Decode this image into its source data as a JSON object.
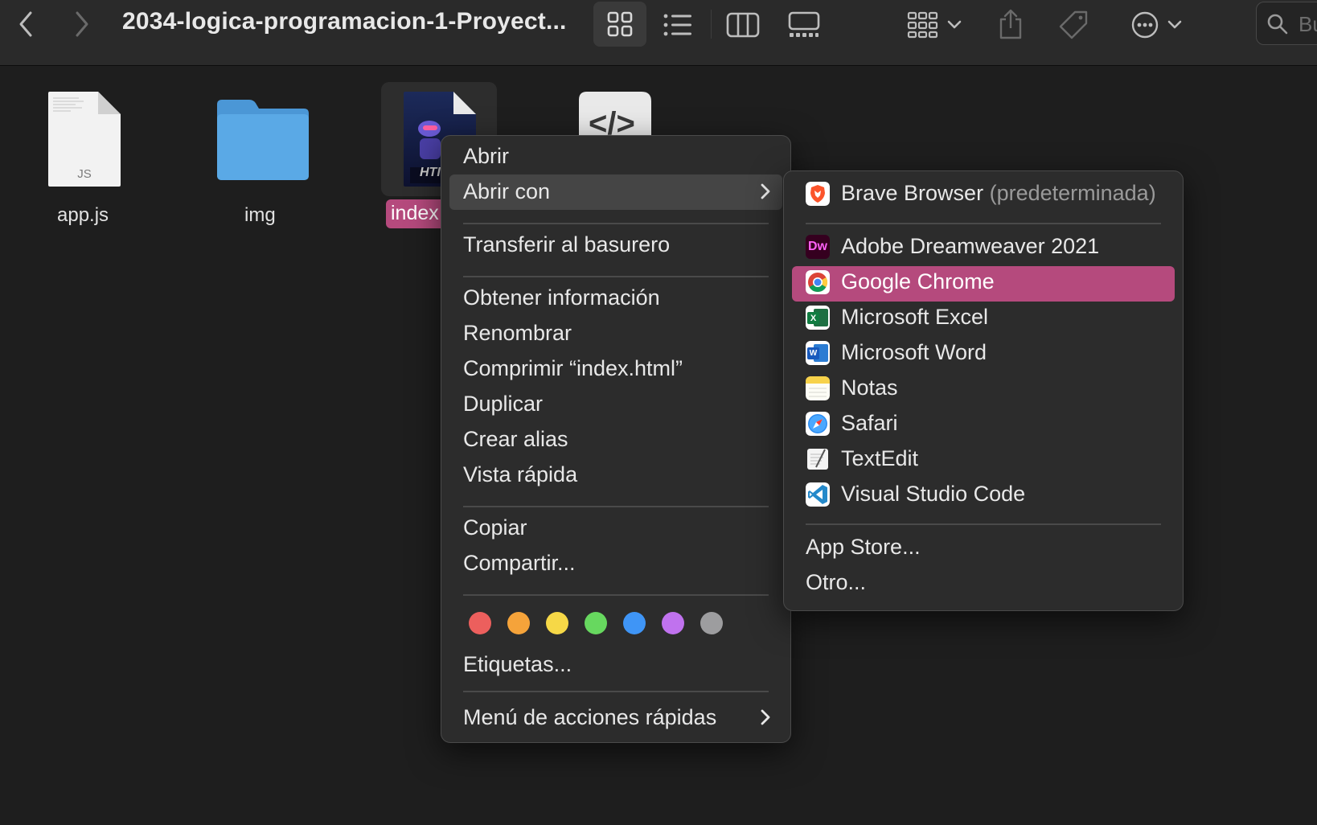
{
  "window": {
    "title": "2034-logica-programacion-1-Proyect...",
    "search_placeholder": "Bu"
  },
  "toolbar": {
    "icons": [
      "chevron-left-icon",
      "chevron-right-icon",
      "icon-view-icon",
      "list-view-icon",
      "column-view-icon",
      "gallery-view-icon",
      "group-icon",
      "share-icon",
      "tag-icon",
      "more-icon",
      "search-icon"
    ]
  },
  "files": [
    {
      "name": "app.js",
      "type_label": "JS",
      "kind": "js-file"
    },
    {
      "name": "img",
      "kind": "folder"
    },
    {
      "name": "index",
      "type_label": "HTI",
      "kind": "html-file",
      "selected": true
    },
    {
      "name": "",
      "type_label": "</>",
      "kind": "code-file"
    }
  ],
  "context_menu": {
    "items": [
      {
        "label": "Abrir"
      },
      {
        "label": "Abrir con",
        "submenu": true,
        "state": "hover"
      },
      {
        "label": "Transferir al basurero"
      },
      {
        "label": "Obtener información"
      },
      {
        "label": "Renombrar"
      },
      {
        "label": "Comprimir “index.html”"
      },
      {
        "label": "Duplicar"
      },
      {
        "label": "Crear alias"
      },
      {
        "label": "Vista rápida"
      },
      {
        "label": "Copiar"
      },
      {
        "label": "Compartir..."
      },
      {
        "label": "Etiquetas..."
      },
      {
        "label": "Menú de acciones rápidas",
        "submenu": true
      }
    ],
    "tag_colors": [
      {
        "name": "red",
        "color": "#ec5f5d"
      },
      {
        "name": "orange",
        "color": "#f5a33a"
      },
      {
        "name": "yellow",
        "color": "#f6d847"
      },
      {
        "name": "green",
        "color": "#67d85f"
      },
      {
        "name": "blue",
        "color": "#3f95f6"
      },
      {
        "name": "purple",
        "color": "#c072ee"
      },
      {
        "name": "gray",
        "color": "#9d9d9f"
      }
    ]
  },
  "open_with_menu": {
    "default_app": {
      "label": "Brave Browser",
      "suffix": "(predeterminada)",
      "icon": "brave-icon"
    },
    "apps": [
      {
        "label": "Adobe Dreamweaver 2021",
        "icon": "dreamweaver-icon",
        "icon_text": "Dw"
      },
      {
        "label": "Google Chrome",
        "icon": "chrome-icon",
        "state": "selected"
      },
      {
        "label": "Microsoft Excel",
        "icon": "excel-icon",
        "icon_text": "X"
      },
      {
        "label": "Microsoft Word",
        "icon": "word-icon",
        "icon_text": "W"
      },
      {
        "label": "Notas",
        "icon": "notes-icon"
      },
      {
        "label": "Safari",
        "icon": "safari-icon"
      },
      {
        "label": "TextEdit",
        "icon": "textedit-icon"
      },
      {
        "label": "Visual Studio Code",
        "icon": "vscode-icon"
      }
    ],
    "footer": [
      {
        "label": "App Store..."
      },
      {
        "label": "Otro..."
      }
    ]
  },
  "colors": {
    "selection_pink": "#b54a7d",
    "folder_blue": "#5aa9e6"
  }
}
